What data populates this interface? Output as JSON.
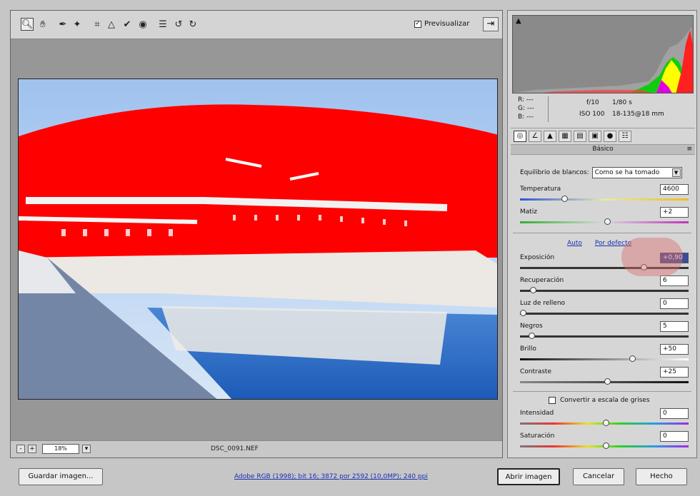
{
  "toolbar": {
    "tools": [
      "zoom-icon",
      "hand-icon",
      "white-balance-icon",
      "color-sampler-icon",
      "crop-icon",
      "straighten-icon",
      "spot-removal-icon",
      "red-eye-icon",
      "preferences-icon",
      "rotate-left-icon",
      "rotate-right-icon"
    ],
    "preview_label": "Previsualizar",
    "preview_checked": true
  },
  "statusbar": {
    "zoom": "18%",
    "filename": "DSC_0091.NEF"
  },
  "histogram": {
    "corner": "▲"
  },
  "info": {
    "r": "R: ---",
    "g": "G: ---",
    "b": "B: ---",
    "aperture": "f/10",
    "shutter": "1/80 s",
    "iso": "ISO 100",
    "lens": "18-135@18 mm"
  },
  "panel": {
    "title": "Básico",
    "tabs": [
      "basic-icon",
      "tone-curve-icon",
      "detail-icon",
      "hsl-icon",
      "split-toning-icon",
      "lens-icon",
      "camera-calibration-icon",
      "presets-icon"
    ]
  },
  "white_balance": {
    "label": "Equilibrio de blancos:",
    "value": "Como se ha tomado"
  },
  "auto": {
    "auto_label": "Auto",
    "default_label": "Por defecto"
  },
  "grayscale": {
    "label": "Convertir a escala de grises",
    "checked": false
  },
  "sliders": [
    {
      "key": "temperatura",
      "label": "Temperatura",
      "value": "4600",
      "pos": 0.25
    },
    {
      "key": "matiz",
      "label": "Matiz",
      "value": "+2",
      "pos": 0.51
    },
    {
      "key": "exposicion",
      "label": "Exposición",
      "value": "+0,90",
      "pos": 0.73
    },
    {
      "key": "recuperacion",
      "label": "Recuperación",
      "value": "6",
      "pos": 0.06
    },
    {
      "key": "luz",
      "label": "Luz de relleno",
      "value": "0",
      "pos": 0.0
    },
    {
      "key": "negros",
      "label": "Negros",
      "value": "5",
      "pos": 0.05
    },
    {
      "key": "brillo",
      "label": "Brillo",
      "value": "+50",
      "pos": 0.66
    },
    {
      "key": "contraste",
      "label": "Contraste",
      "value": "+25",
      "pos": 0.51
    },
    {
      "key": "intensidad",
      "label": "Intensidad",
      "value": "0",
      "pos": 0.5
    },
    {
      "key": "saturacion",
      "label": "Saturación",
      "value": "0",
      "pos": 0.5
    }
  ],
  "bottom": {
    "save_label": "Guardar imagen...",
    "workflow": "Adobe RGB (1998); bit 16; 3872 por 2592 (10,0MP); 240 ppi",
    "open_label": "Abrir imagen",
    "cancel_label": "Cancelar",
    "done_label": "Hecho"
  }
}
